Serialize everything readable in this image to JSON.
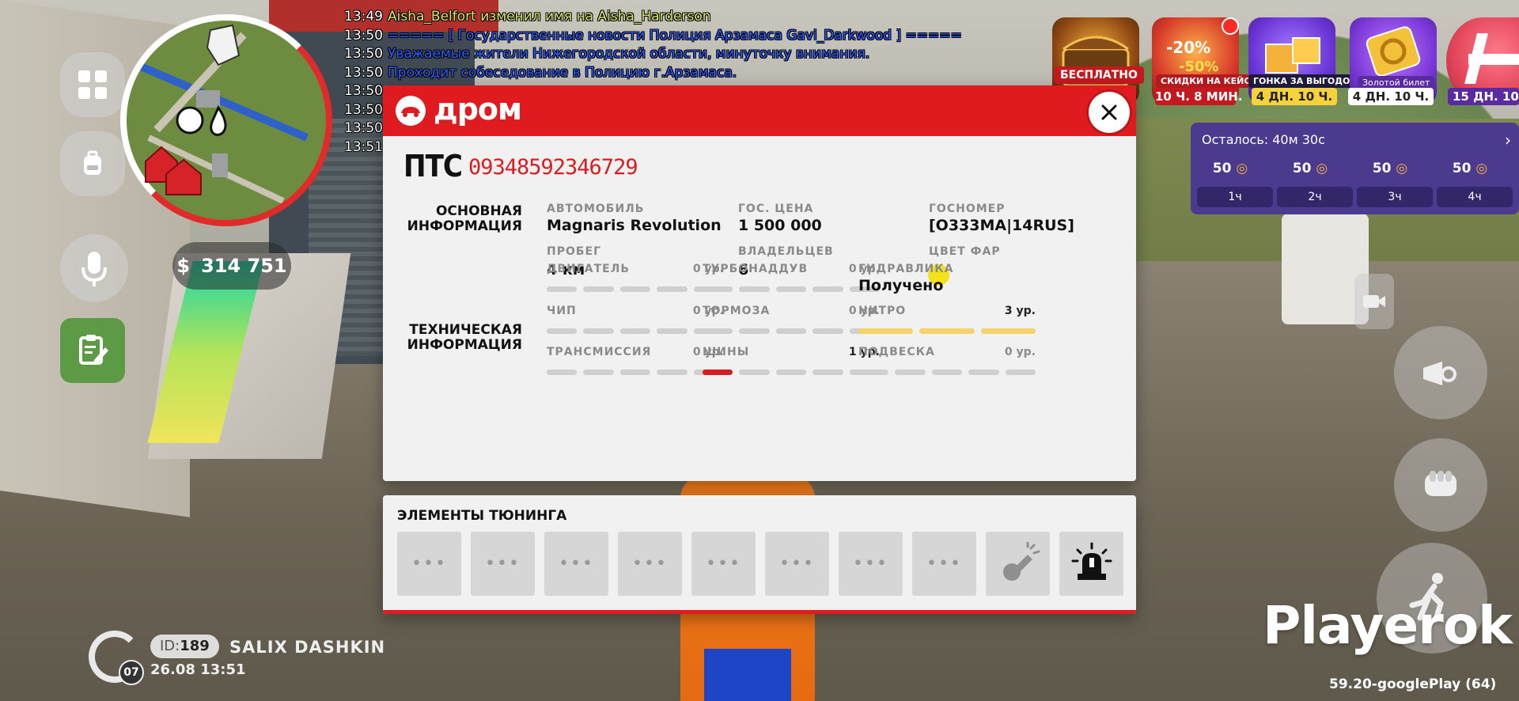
{
  "chat": [
    {
      "time": "13:49",
      "text": "Aisha_Belfort изменил имя на Aisha_Harderson",
      "color": "#d7e86b"
    },
    {
      "time": "13:50",
      "text": "===== [ Государственные новости Полиция Арзамаса Gavi_Darkwood ] =====",
      "color": "#2f5cff"
    },
    {
      "time": "13:50",
      "text": "Уважаемые жители Нижегородской области, минуточку внимания.",
      "color": "#2f5cff"
    },
    {
      "time": "13:50",
      "text": "Проходит собеседование в Полицию г.Арзамаса.",
      "color": "#2f5cff"
    },
    {
      "time": "13:50",
      "text": "",
      "color": "#2f5cff"
    },
    {
      "time": "13:50",
      "text": "",
      "color": "#2f5cff"
    },
    {
      "time": "13:50",
      "text": "",
      "color": "#2f5cff"
    },
    {
      "time": "13:51",
      "text": "",
      "color": "#2f5cff"
    }
  ],
  "hud": {
    "money": "314 751",
    "money_symbol": "$",
    "player_id_prefix": "ID:",
    "player_id": "189",
    "player_name": "SALIX DASHKIN",
    "datetime": "26.08 13:51",
    "level": "07",
    "watermark": "Playerok",
    "version": "59.20-googlePlay (64)"
  },
  "promos": [
    {
      "label": "БЕСПЛАТНО",
      "timer": "",
      "icon": "chest-icon"
    },
    {
      "label": "СКИДКИ НА КЕЙСЫ",
      "timer": "10 Ч. 8 МИН.",
      "icon": "discount-cases-icon"
    },
    {
      "label": "ГОНКА ЗА ВЫГОДОЙ",
      "timer": "4 ДН. 10 Ч.",
      "icon": "gift-race-icon"
    },
    {
      "label": "Золотой билет",
      "timer": "4 ДН. 10 Ч.",
      "icon": "golden-ticket-icon"
    },
    {
      "label": "",
      "timer": "15 ДН. 10",
      "icon": "plus-icon"
    }
  ],
  "rewards": {
    "title": "Осталось: 40м 30с",
    "items": [
      {
        "value": "50",
        "slot": "1ч"
      },
      {
        "value": "50",
        "slot": "2ч"
      },
      {
        "value": "50",
        "slot": "3ч"
      },
      {
        "value": "50",
        "slot": "4ч"
      }
    ]
  },
  "modal": {
    "brand": "дром",
    "title": "ПТС",
    "number": "09348592346729",
    "colors": {
      "brand_red": "#df1b1f",
      "headlight": "#f2e217"
    },
    "main_section_line1": "ОСНОВНАЯ",
    "main_section_line2": "ИНФОРМАЦИЯ",
    "main_fields": [
      {
        "label": "АВТОМОБИЛЬ",
        "value": "Magnaris Revolution"
      },
      {
        "label": "ГОС. ЦЕНА",
        "value": "1 500 000"
      },
      {
        "label": "ГОСНОМЕР",
        "value": "[О333МА|14RUS]"
      },
      {
        "label": "ПРОБЕГ",
        "value": "4 км"
      },
      {
        "label": "ВЛАДЕЛЬЦЕВ",
        "value": "6"
      },
      {
        "label": "ЦВЕТ ФАР",
        "value": ""
      }
    ],
    "tech_section_line1": "ТЕХНИЧЕСКАЯ",
    "tech_section_line2": "ИНФОРМАЦИЯ",
    "tech_fields": [
      {
        "label": "ДВИГАТЕЛЬ",
        "level_text": "0 ур.",
        "level": 0,
        "max": 5
      },
      {
        "label": "ТУРБОНАДДУВ",
        "level_text": "0 ур.",
        "level": 0,
        "max": 5
      },
      {
        "label": "ГИДРАВЛИКА",
        "value": "Получено"
      },
      {
        "label": "ЧИП",
        "level_text": "0 ур.",
        "level": 0,
        "max": 5
      },
      {
        "label": "ТОРМОЗА",
        "level_text": "0 ур.",
        "level": 0,
        "max": 5
      },
      {
        "label": "НИТРО",
        "level_text": "3 ур.",
        "level": 3,
        "max": 3
      },
      {
        "label": "ТРАНСМИССИЯ",
        "level_text": "0 ур.",
        "level": 0,
        "max": 5
      },
      {
        "label": "ШИНЫ",
        "level_text": "1 ур.",
        "level": 1,
        "max": 5
      },
      {
        "label": "ПОДВЕСКА",
        "level_text": "0 ур.",
        "level": 0,
        "max": 5
      }
    ]
  },
  "tuning": {
    "title": "ЭЛЕМЕНТЫ ТЮНИНГА",
    "slots": [
      {
        "icon": "more-dots-icon",
        "text": "•••"
      },
      {
        "icon": "more-dots-icon",
        "text": "•••"
      },
      {
        "icon": "more-dots-icon",
        "text": "•••"
      },
      {
        "icon": "more-dots-icon",
        "text": "•••"
      },
      {
        "icon": "more-dots-icon",
        "text": "•••"
      },
      {
        "icon": "more-dots-icon",
        "text": "•••"
      },
      {
        "icon": "more-dots-icon",
        "text": "•••"
      },
      {
        "icon": "more-dots-icon",
        "text": "•••"
      },
      {
        "icon": "horn-icon",
        "text": ""
      },
      {
        "icon": "siren-icon",
        "text": ""
      }
    ]
  }
}
